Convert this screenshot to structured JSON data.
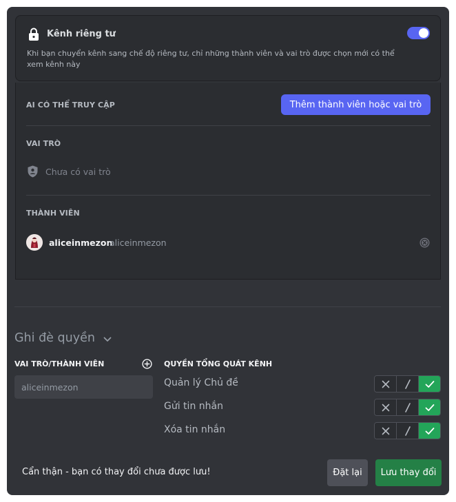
{
  "private_channel": {
    "title": "Kênh riêng tư",
    "description": "Khi bạn chuyển kênh sang chế độ riêng tư, chỉ những thành viên và vai trò được chọn mới có thể xem kênh này",
    "toggle_enabled": true,
    "icon": "lock-icon"
  },
  "access": {
    "label": "AI CÓ THỂ TRUY CẬP",
    "add_button_label": "Thêm thành viên hoặc vai trò",
    "roles_label": "VAI TRÒ",
    "no_roles_text": "Chưa có vai trò",
    "members_label": "THÀNH VIÊN",
    "members": [
      {
        "display_name": "aliceinmezon",
        "username": "aliceinmezon"
      }
    ]
  },
  "overrides": {
    "title": "Ghi đè quyền",
    "roles_members_label": "VAI TRÒ/THÀNH VIÊN",
    "general_permissions_label": "QUYỀN TỔNG QUÁT KÊNH",
    "selected_entry": "aliceinmezon",
    "permissions": [
      {
        "name": "Quản lý Chủ đề",
        "state": "allow"
      },
      {
        "name": "Gửi tin nhắn",
        "state": "allow"
      },
      {
        "name": "Xóa tin nhắn",
        "state": "allow"
      }
    ]
  },
  "unsaved_bar": {
    "message": "Cẩn thận - bạn có thay đổi chưa được lưu!",
    "reset_label": "Đặt lại",
    "save_label": "Lưu thay đổi"
  },
  "colors": {
    "accent": "#5865f2",
    "allow_green": "#23a559",
    "save_button": "#248046",
    "panel_bg": "#313338"
  }
}
